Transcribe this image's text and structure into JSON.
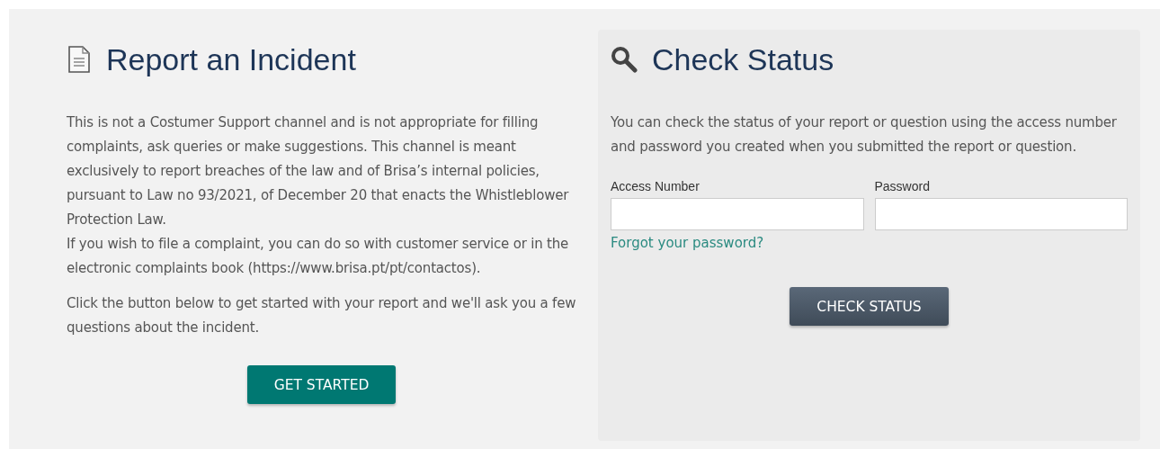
{
  "report": {
    "title": "Report an Incident",
    "blocks": [
      {
        "lines": [
          "This is not a Costumer Support channel and is not appropriate for filling complaints, ask queries or make suggestions. This channel is meant exclusively to report breaches of the law and of Brisa’s internal policies, pursuant to Law no 93/2021, of December 20 that enacts the Whistleblower Protection Law.",
          "If you wish to file a complaint, you can do so with customer service or in the electronic complaints book (https://www.brisa.pt/pt/contactos)."
        ]
      },
      {
        "lines": [
          "Click the button below to get started with your report and we'll ask you a few questions about the incident."
        ]
      }
    ],
    "button": "GET STARTED"
  },
  "status": {
    "title": "Check Status",
    "description": "You can check the status of your report or question using the access number and password you created when you submitted the report or question.",
    "fields": [
      {
        "label": "Access Number"
      },
      {
        "label": "Password"
      }
    ],
    "link": "Forgot your password?",
    "button": "CHECK STATUS"
  }
}
